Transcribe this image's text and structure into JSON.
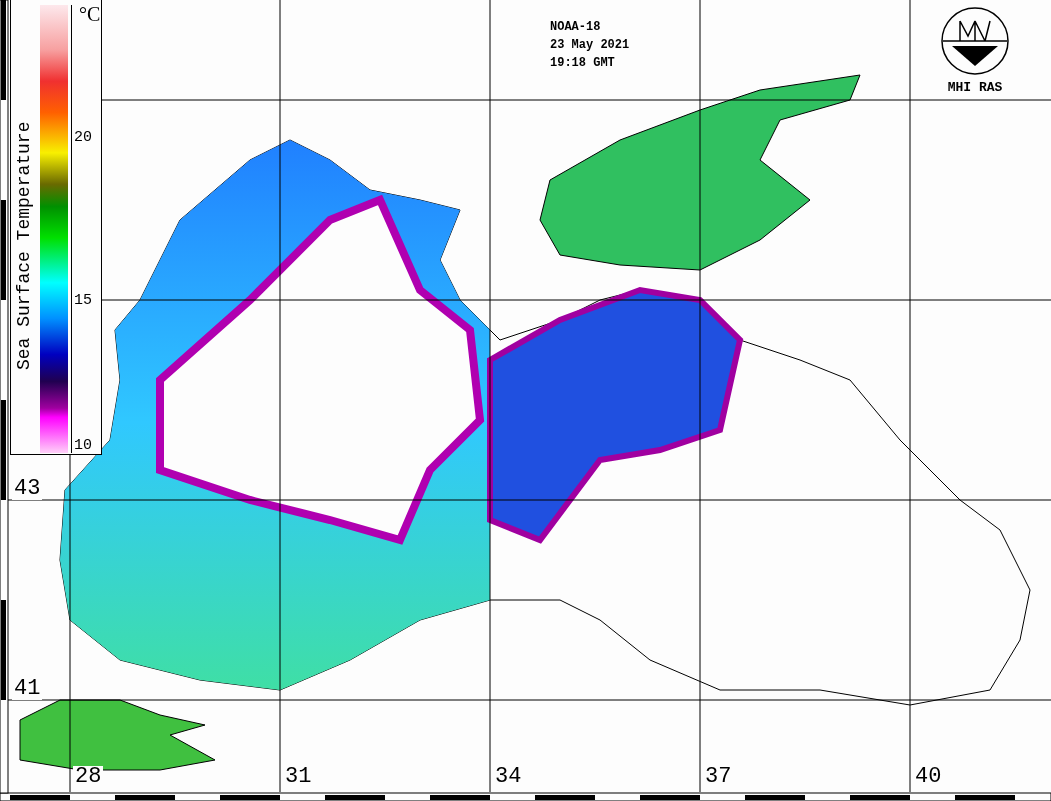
{
  "map": {
    "title_lines": [
      "NOAA-18",
      "23 May 2021",
      "19:18 GMT"
    ],
    "logo_text": "MHI RAS",
    "legend": {
      "title": "Sea Surface Temperature",
      "unit": "°C",
      "ticks": [
        "20",
        "15",
        "10"
      ]
    },
    "latitude_labels": [
      "43",
      "41"
    ],
    "longitude_labels": [
      "28",
      "31",
      "34",
      "37",
      "40"
    ]
  }
}
